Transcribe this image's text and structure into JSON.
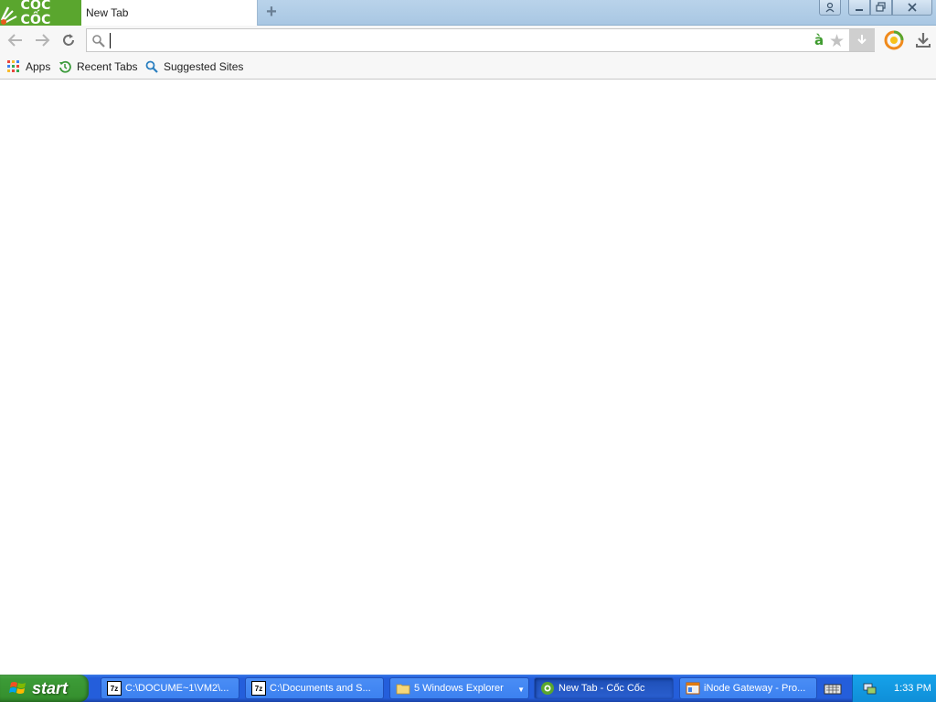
{
  "window": {
    "brand_text": "CỐC CỐC",
    "tabs": [
      {
        "label": "New Tab",
        "active": true
      }
    ],
    "new_tab_glyph": "+",
    "controls": {
      "profile": "profile-icon",
      "minimize": "minimize-icon",
      "restore": "restore-icon",
      "close": "close-icon"
    }
  },
  "toolbar": {
    "omnibox": {
      "value": "",
      "placeholder": ""
    },
    "icons": [
      "back-arrow-icon",
      "forward-arrow-icon",
      "reload-icon",
      "search-icon",
      "translate-icon",
      "star-icon",
      "savior-download-icon",
      "extension-icon",
      "download-icon"
    ],
    "translate_glyph": "à"
  },
  "bookmarks": {
    "items": [
      {
        "label": "Apps",
        "icon": "apps-grid-icon"
      },
      {
        "label": "Recent Tabs",
        "icon": "history-icon"
      },
      {
        "label": "Suggested Sites",
        "icon": "search-icon"
      }
    ]
  },
  "taskbar": {
    "start_label": "start",
    "tasks": [
      {
        "label": "C:\\DOCUME~1\\VM2\\...",
        "icon": "7zip-icon"
      },
      {
        "label": "C:\\Documents and S...",
        "icon": "7zip-icon"
      },
      {
        "label": "5 Windows Explorer",
        "icon": "folder-icon"
      },
      {
        "label": "New Tab - Cốc Cốc",
        "icon": "coccoc-icon",
        "active": true
      },
      {
        "label": "iNode Gateway - Pro...",
        "icon": "window-icon"
      }
    ],
    "clock": "1:33 PM"
  },
  "colors": {
    "brand_green": "#5aa62e",
    "titlebar_blue": "#b0cde7",
    "taskbar_blue": "#245edb",
    "start_green": "#3c9b37",
    "tray_blue": "#0f8fd8"
  }
}
